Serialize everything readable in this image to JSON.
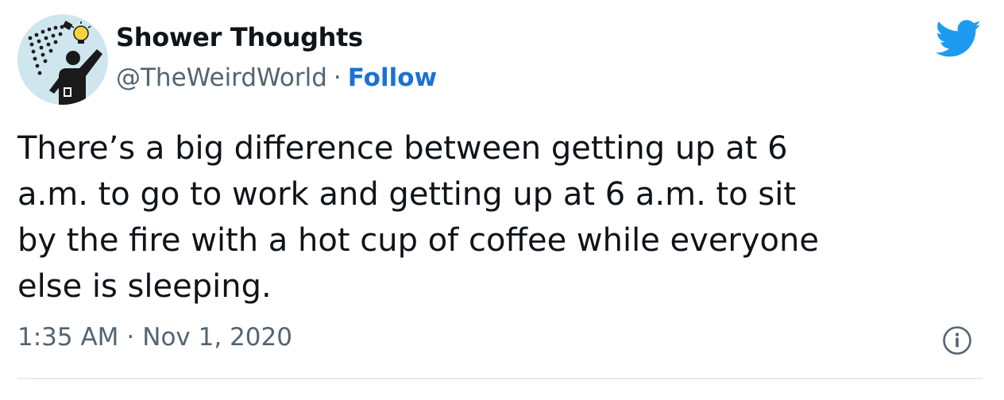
{
  "tweet": {
    "display_name": "Shower Thoughts",
    "handle": "@TheWeirdWorld",
    "separator": "·",
    "follow_label": "Follow",
    "text": "There’s a big difference between getting up at 6\na.m. to go to work and getting up at 6 a.m. to sit\nby the fire with a hot cup of coffee while everyone\nelse is sleeping.",
    "time": "1:35 AM",
    "date": "Nov 1, 2020"
  },
  "icons": {
    "brand": "twitter-bird-icon",
    "info": "info-icon",
    "avatar": "shower-lightbulb-avatar"
  },
  "colors": {
    "brand_blue": "#1d9bf0",
    "link_blue": "#1b72d3",
    "text_primary": "#0f1419",
    "text_secondary": "#536471",
    "avatar_bg": "#cfe6ee"
  }
}
